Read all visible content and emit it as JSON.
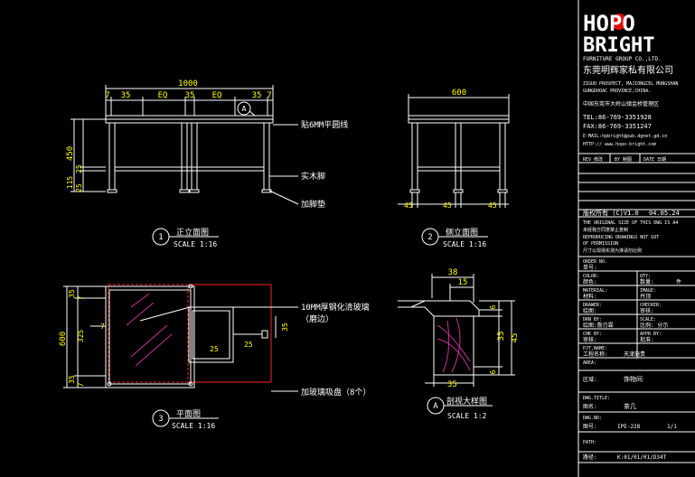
{
  "colors": {
    "background": "#000000",
    "lines": "#ffffff",
    "dimensions": "#ffff00",
    "hidden": "#ff2020",
    "hatch": "#cc3399",
    "brand_red": "#dd1111"
  },
  "front_view": {
    "overall": "1000",
    "segments": [
      "7",
      "35",
      "EQ",
      "35",
      "EQ",
      "35",
      "7"
    ],
    "height_dims": [
      "450",
      "25",
      "115",
      "25"
    ],
    "bubble_mark": "A",
    "callout_top": "贴6MM平圆线",
    "callout_mid": "实木脚",
    "callout_bottom": "加脚垫",
    "number": "1",
    "title": "正立面图",
    "scale": "SCALE 1:16"
  },
  "side_view": {
    "overall": "600",
    "bottom_dims": [
      "45",
      "45",
      "45"
    ],
    "number": "2",
    "title": "侧立面图",
    "scale": "SCALE 1:16"
  },
  "plan_view": {
    "left_dims": [
      "35",
      "7",
      "325",
      "600",
      "35",
      "7"
    ],
    "dim_25a": "25",
    "dim_25b": "25",
    "dim_35": "35",
    "callout_glass": "10MM厚钢化清玻璃",
    "callout_glass_sub": "（磨边）",
    "callout_pads": "加玻璃吸盘（8个）",
    "number": "3",
    "title": "平面图",
    "scale": "SCALE 1:16"
  },
  "detail_view": {
    "dim_top": "38",
    "dim_inner": "15",
    "dim_right_a": "6",
    "dim_right_b": "35",
    "dim_right_c": "6",
    "dim_right_d": "45",
    "dim_bottom": "35",
    "number": "A",
    "title": "剖视大样图",
    "scale": "SCALE 1:2"
  },
  "title_block": {
    "logo_line1": "HOPO",
    "logo_line2": "BRIGHT",
    "logo_sub": "FURNITURE GROUP CO.,LTD.",
    "company_cn": "东莞明辉家私有限公司",
    "address_en1": "ZIGUO PROSPECT, MAJIONGCEL MUNGSHAN",
    "address_en2": "GUNGDOOAC PROVINCE,CHINA.",
    "address_cn": "中国东莞市大岭山镇金桥管理区",
    "tel": "TEL:86-769-3351928",
    "fax": "FAX:86-769-3351247",
    "email": "E-MAIL:hpbright@pub.dgnet.gd.cn",
    "http": "HTTP:// www.hopo-bright.com",
    "rev_header": [
      "REV 修改",
      "BY 制图",
      "DATE 日期"
    ],
    "version": "版权所有 (C)V1.0",
    "date": "04.05.24",
    "notice": [
      "THE ORIGINAL SIZE OF THIS DWG IS A4",
      "未经我方同意禁止复制",
      "REPRODUCING DRAWINGS NOT GOT",
      "OF PERMISSION",
      "尺寸以现场实测为准请勿比例"
    ],
    "fields": [
      {
        "label": "ORDER NO.",
        "value": ""
      },
      {
        "label": "单号:",
        "value": ""
      },
      {
        "label": "COLOR:",
        "value": "QTY:"
      },
      {
        "label": "颜色:",
        "value": "数量:"
      },
      {
        "label": "",
        "value": "件"
      },
      {
        "label": "MATERIAL:",
        "value": "IMAGE:"
      },
      {
        "label": "材料:",
        "value": "丹顶"
      },
      {
        "label": "DRAWER:",
        "value": "CHECKER:"
      },
      {
        "label": "绘图:",
        "value": "审核:"
      },
      {
        "label": "DRN BY:",
        "value": "SCALE:"
      },
      {
        "label": "绘图:詹刃霖",
        "value": "比例: 分示"
      },
      {
        "label": "CHK BY:",
        "value": "APPR BY:"
      },
      {
        "label": "审核:",
        "value": "批准:"
      },
      {
        "label": "PJT.NAME:",
        "value": ""
      },
      {
        "label": "工程名称:",
        "value": "天津施贵"
      },
      {
        "label": "AREA:",
        "value": ""
      },
      {
        "label": "区域:",
        "value": "饰物间"
      },
      {
        "label": "DWG.TITLE:",
        "value": ""
      },
      {
        "label": "图名:",
        "value": "茶几"
      },
      {
        "label": "DWG.NO:",
        "value": ""
      },
      {
        "label": "图号:",
        "value": "IPE-228"
      },
      {
        "label": "",
        "value": "1/1"
      },
      {
        "label": "PATH:",
        "value": ""
      },
      {
        "label": "路径:",
        "value": "K:01/01/01/D34T"
      }
    ]
  }
}
